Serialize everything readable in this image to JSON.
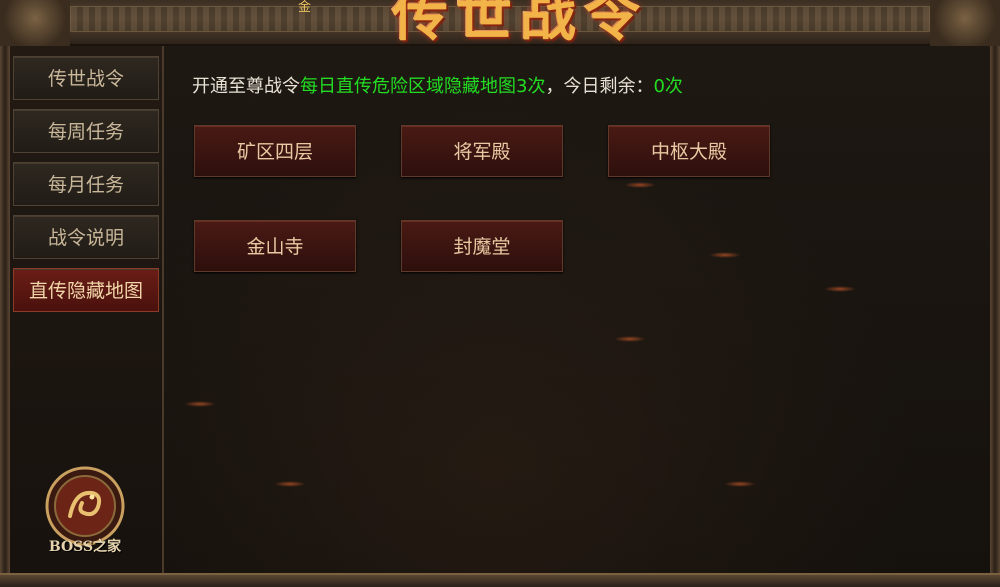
{
  "header": {
    "title": "传世战令",
    "tag": "金"
  },
  "sidebar": {
    "items": [
      {
        "label": "传世战令",
        "active": false
      },
      {
        "label": "每周任务",
        "active": false
      },
      {
        "label": "每月任务",
        "active": false
      },
      {
        "label": "战令说明",
        "active": false
      },
      {
        "label": "直传隐藏地图",
        "active": true
      }
    ],
    "logo_text": "BOSS之家"
  },
  "main": {
    "info_prefix": "开通至尊战令",
    "info_highlight": "每日直传危险区域隐藏地图3次",
    "info_mid": "，今日剩余：",
    "info_remaining": "0次",
    "maps": [
      "矿区四层",
      "将军殿",
      "中枢大殿",
      "金山寺",
      "封魔堂"
    ]
  },
  "colors": {
    "highlight_green": "#22dd22",
    "active_tab": "#6b1d16",
    "title_gold": "#f2b449"
  }
}
